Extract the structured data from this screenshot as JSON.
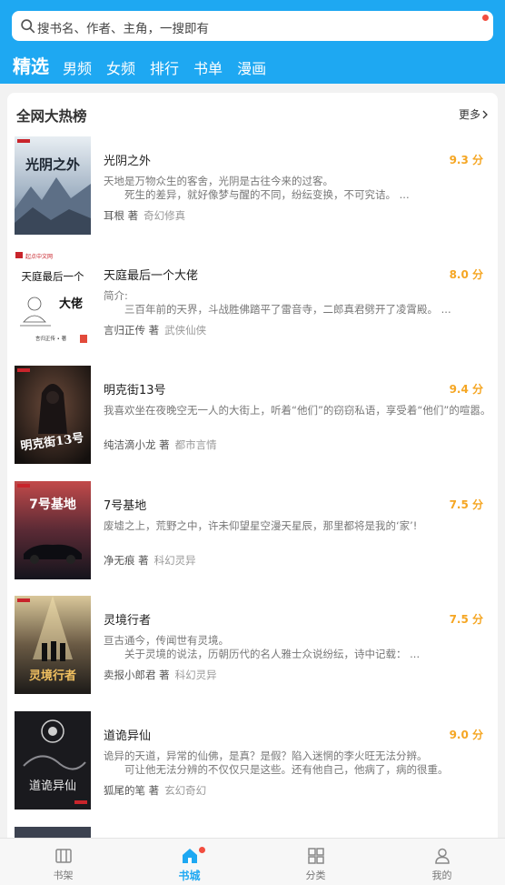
{
  "search": {
    "placeholder": "搜书名、作者、主角，一搜即有"
  },
  "tabs": [
    {
      "label": "精选"
    },
    {
      "label": "男频"
    },
    {
      "label": "女频"
    },
    {
      "label": "排行"
    },
    {
      "label": "书单"
    },
    {
      "label": "漫画"
    }
  ],
  "section": {
    "title": "全网大热榜",
    "more_label": "更多"
  },
  "books": [
    {
      "title": "光阴之外",
      "score": "9.3 分",
      "desc1": "天地是万物众生的客舍，光阴是古往今来的过客。",
      "desc2": "　　死生的差异，就好像梦与醒的不同，纷纭变换，不可究诘。 ...",
      "author": "耳根 著",
      "tags": "奇幻修真",
      "cover_text": "光阴之外"
    },
    {
      "title": "天庭最后一个大佬",
      "score": "8.0 分",
      "desc1": "简介:",
      "desc2": "　　三百年前的天界，斗战胜佛踏平了雷音寺，二郎真君劈开了凌霄殿。 ...",
      "author": "言归正传 著",
      "tags": "武侠仙侠",
      "cover_text1": "天庭最后一个",
      "cover_text2": "大佬",
      "cover_brand": "起点中文网",
      "cover_author": "言归正传 • 著"
    },
    {
      "title": "明克街13号",
      "score": "9.4 分",
      "desc1": "我喜欢坐在夜晚空无一人的大街上，听着“他们”的窃窃私语，享受着“他们”的喧嚣。",
      "desc2": "",
      "author": "纯洁滴小龙 著",
      "tags": "都市言情",
      "cover_text": "明克街13号"
    },
    {
      "title": "7号基地",
      "score": "7.5 分",
      "desc1": "废墟之上，荒野之中，许未仰望星空漫天星辰，那里都将是我的‘家’!",
      "desc2": "",
      "author": "净无痕 著",
      "tags": "科幻灵异",
      "cover_text": "7号基地"
    },
    {
      "title": "灵境行者",
      "score": "7.5 分",
      "desc1": "亘古通今，传闻世有灵境。",
      "desc2": "　　关于灵境的说法，历朝历代的名人雅士众说纷纭，诗中记载： ...",
      "author": "卖报小郎君 著",
      "tags": "科幻灵异",
      "cover_text": "灵境行者"
    },
    {
      "title": "道诡异仙",
      "score": "9.0 分",
      "desc1": "诡异的天道，异常的仙佛，是真？是假？陷入迷惘的李火旺无法分辨。",
      "desc2": "　　可让他无法分辨的不仅仅只是这些。还有他自己，他病了，病的很重。",
      "author": "狐尾的笔 著",
      "tags": "玄幻奇幻",
      "cover_text": "道诡异仙"
    }
  ],
  "bottom_nav": [
    {
      "label": "书架",
      "icon": "bookshelf-icon"
    },
    {
      "label": "书城",
      "icon": "bookstore-home-icon"
    },
    {
      "label": "分类",
      "icon": "category-grid-icon"
    },
    {
      "label": "我的",
      "icon": "profile-icon"
    }
  ],
  "colors": {
    "primary": "#1ea8f2",
    "score": "#f5a623",
    "badge": "#f24d3f"
  }
}
